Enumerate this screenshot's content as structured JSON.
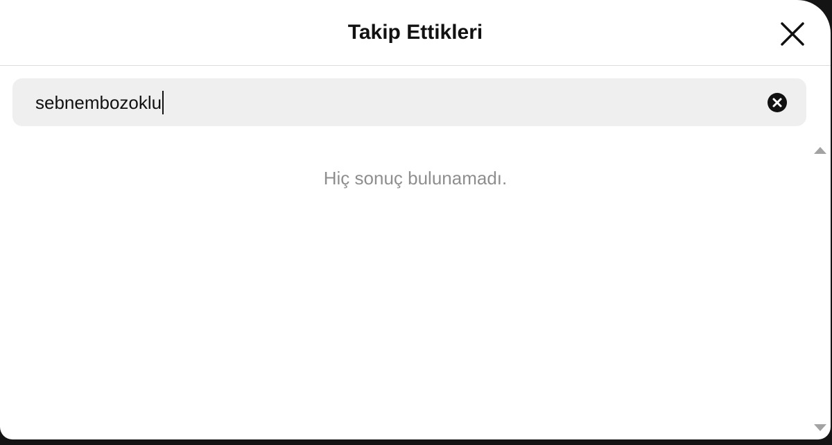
{
  "dialog": {
    "title": "Takip Ettikleri",
    "close_icon": "close-icon"
  },
  "search": {
    "value": "sebnembozoklu",
    "clear_icon": "clear-circle-x-icon"
  },
  "results": {
    "empty_message": "Hiç sonuç bulunamadı."
  },
  "scrollbar": {
    "up_icon": "scroll-up-arrow-icon",
    "down_icon": "scroll-down-arrow-icon"
  },
  "colors": {
    "background": "#ffffff",
    "search_background": "#efefef",
    "muted_text": "#8e8e8e",
    "primary_text": "#111111"
  }
}
